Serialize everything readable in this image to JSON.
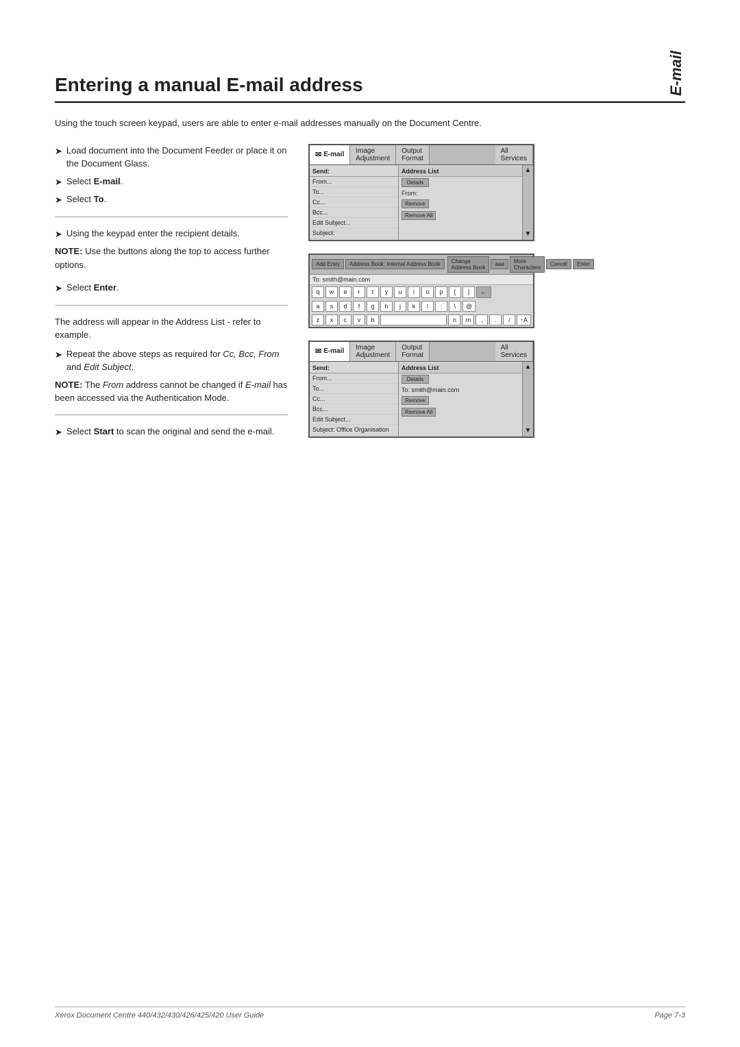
{
  "header": {
    "title": "Entering a manual E-mail address",
    "side_label": "E-mail"
  },
  "intro": {
    "text": "Using the touch screen keypad, users are able to enter e-mail addresses manually on the Document Centre."
  },
  "sections": [
    {
      "id": "section1",
      "steps": [
        {
          "arrow": "➤",
          "text": "Load document into the Document Feeder or place it on the Document Glass."
        },
        {
          "arrow": "➤",
          "text": "Select ",
          "bold": "E-mail",
          "suffix": "."
        },
        {
          "arrow": "➤",
          "text": "Select ",
          "bold": "To",
          "suffix": "."
        }
      ]
    },
    {
      "id": "section2",
      "steps": [
        {
          "arrow": "➤",
          "text": "Using the keypad enter the recipient details."
        }
      ],
      "note": {
        "label": "NOTE:",
        "text": " Use the buttons along the top to access further options."
      }
    },
    {
      "id": "section3",
      "steps": [
        {
          "arrow": "➤",
          "text": "Select ",
          "bold": "Enter",
          "suffix": "."
        }
      ]
    },
    {
      "id": "section4",
      "intro": "The address will appear in the Address List - refer to example.",
      "steps": [
        {
          "arrow": "➤",
          "text": "Repeat the above steps as required for ",
          "italic": "Cc, Bcc, From",
          "suffix": " and ",
          "italic2": "Edit Subject",
          "suffix2": "."
        }
      ],
      "note": {
        "label": "NOTE:",
        "text": " The ",
        "italic": "From",
        "text2": " address cannot be changed if ",
        "italic2": "E-mail",
        "text3": " has been accessed via the Authentication Mode."
      }
    },
    {
      "id": "section5",
      "steps": [
        {
          "arrow": "➤",
          "text": "Select ",
          "bold": "Start",
          "suffix": " to scan the original and send the e-mail."
        }
      ]
    }
  ],
  "screen1": {
    "tabs": [
      {
        "label": "E-mail",
        "icon": "✉",
        "active": true
      },
      {
        "label": "Image\nAdjustment",
        "active": false
      },
      {
        "label": "Output\nFormat",
        "active": false
      },
      {
        "label": "All\nServices",
        "active": false
      }
    ],
    "send_label": "Send:",
    "fields": [
      "From...",
      "To...",
      "Cc...",
      "Bcc...",
      "Edit Subject...",
      "Subject:"
    ],
    "address_header": "Address List",
    "address_from": "From:",
    "buttons": [
      "Details",
      "Remove",
      "Remove All"
    ]
  },
  "keyboard": {
    "toolbar_buttons": [
      "Add Entry",
      "Address Book: Internal Address Book",
      "Change\nAddress Book",
      "aaa",
      "More\nCharacters",
      "Cancel",
      "Enter"
    ],
    "to_value": "To: smith@main.com",
    "rows": [
      [
        "q",
        "w",
        "e",
        "r",
        "t",
        "y",
        "u",
        "i",
        "o",
        "p",
        "[",
        "]",
        "←"
      ],
      [
        "a",
        "s",
        "d",
        "f",
        "g",
        "h",
        "j",
        "k",
        "l",
        ":",
        "\\",
        "@"
      ],
      [
        "z",
        "x",
        "c",
        "v",
        "b",
        "space",
        "n",
        "m",
        ",",
        ".",
        "/",
        "↑A"
      ]
    ]
  },
  "screen2": {
    "tabs": [
      {
        "label": "E-mail",
        "icon": "✉",
        "active": true
      },
      {
        "label": "Image\nAdjustment",
        "active": false
      },
      {
        "label": "Output\nFormat",
        "active": false
      },
      {
        "label": "All\nServices",
        "active": false
      }
    ],
    "send_label": "Send:",
    "fields": [
      "From...",
      "To...",
      "Cc...",
      "Bcc...",
      "Edit Subject...",
      "Subject: Office Organisation"
    ],
    "address_header": "Address List",
    "address_to": "To: smith@main.com",
    "buttons": [
      "Details",
      "Remove",
      "Remove All"
    ]
  },
  "footer": {
    "left": "Xerox Document Centre 440/432/430/426/425/420 User Guide",
    "right": "Page 7-3"
  }
}
